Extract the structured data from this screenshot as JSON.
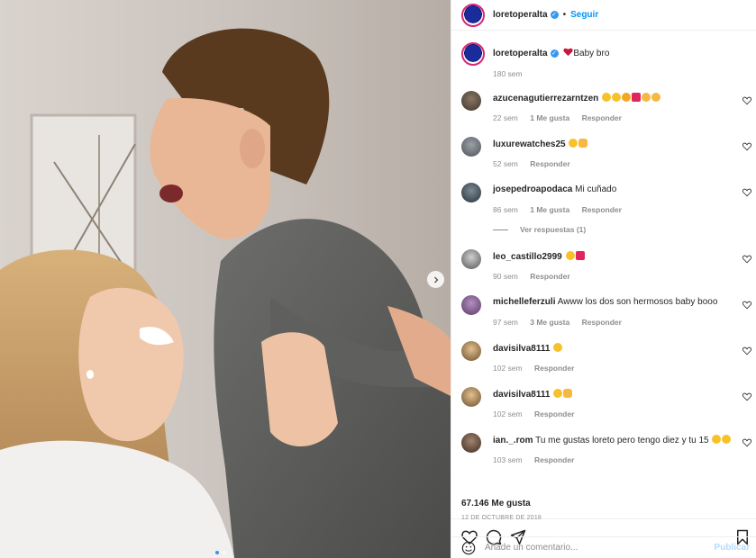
{
  "post": {
    "author": "loretoperalta",
    "follow_label": "Seguir",
    "caption": {
      "username": "loretoperalta",
      "text": "Baby bro",
      "age": "180 sem"
    },
    "comments": [
      {
        "username": "azucenagutierrezarntzen",
        "text": "",
        "emoji": [
          "star-eyes-emoji",
          "star-eyes-emoji",
          "open-hands-emoji",
          "red-heart-emoji",
          "clap-emoji",
          "clap-emoji"
        ],
        "age": "22 sem",
        "likes": "1 Me gusta",
        "reply": "Responder"
      },
      {
        "username": "luxurewatches25",
        "text": "",
        "emoji": [
          "smile-emoji",
          "ok-hand-emoji"
        ],
        "age": "52 sem",
        "likes": "",
        "reply": "Responder"
      },
      {
        "username": "josepedroapodaca",
        "text": "Mi cuñado",
        "emoji": [],
        "age": "86 sem",
        "likes": "1 Me gusta",
        "reply": "Responder"
      },
      {
        "username": "leo_castillo2999",
        "text": "",
        "emoji": [
          "star-eyes-emoji",
          "red-heart-emoji"
        ],
        "age": "90 sem",
        "likes": "",
        "reply": "Responder"
      },
      {
        "username": "michelleferzuli",
        "text": "Awww los dos son hermosos baby booo",
        "emoji": [],
        "age": "97 sem",
        "likes": "3 Me gusta",
        "reply": "Responder"
      },
      {
        "username": "davisilva8111",
        "text": "",
        "emoji": [
          "smile-emoji"
        ],
        "age": "102 sem",
        "likes": "",
        "reply": "Responder"
      },
      {
        "username": "davisilva8111",
        "text": "",
        "emoji": [
          "tongue-wink-emoji",
          "victory-hand-emoji"
        ],
        "age": "102 sem",
        "likes": "",
        "reply": "Responder"
      },
      {
        "username": "ian._.rom",
        "text": "Tu me gustas loreto pero tengo diez y tu 15",
        "emoji": [
          "crying-emoji",
          "crying-emoji"
        ],
        "age": "103 sem",
        "likes": "",
        "reply": "Responder"
      }
    ],
    "view_replies": "Ver respuestas (1)",
    "likes_total": "67.146 Me gusta",
    "date": "12 DE OCTUBRE DE 2018",
    "add_comment_placeholder": "Añade un comentario...",
    "publish_label": "Publicar",
    "colors": {
      "link_blue": "#0095f6",
      "muted": "#8e8e8e",
      "publish_disabled": "#b3dbff",
      "heart_red": "#e0245e",
      "verified_blue": "#3897f0"
    }
  }
}
